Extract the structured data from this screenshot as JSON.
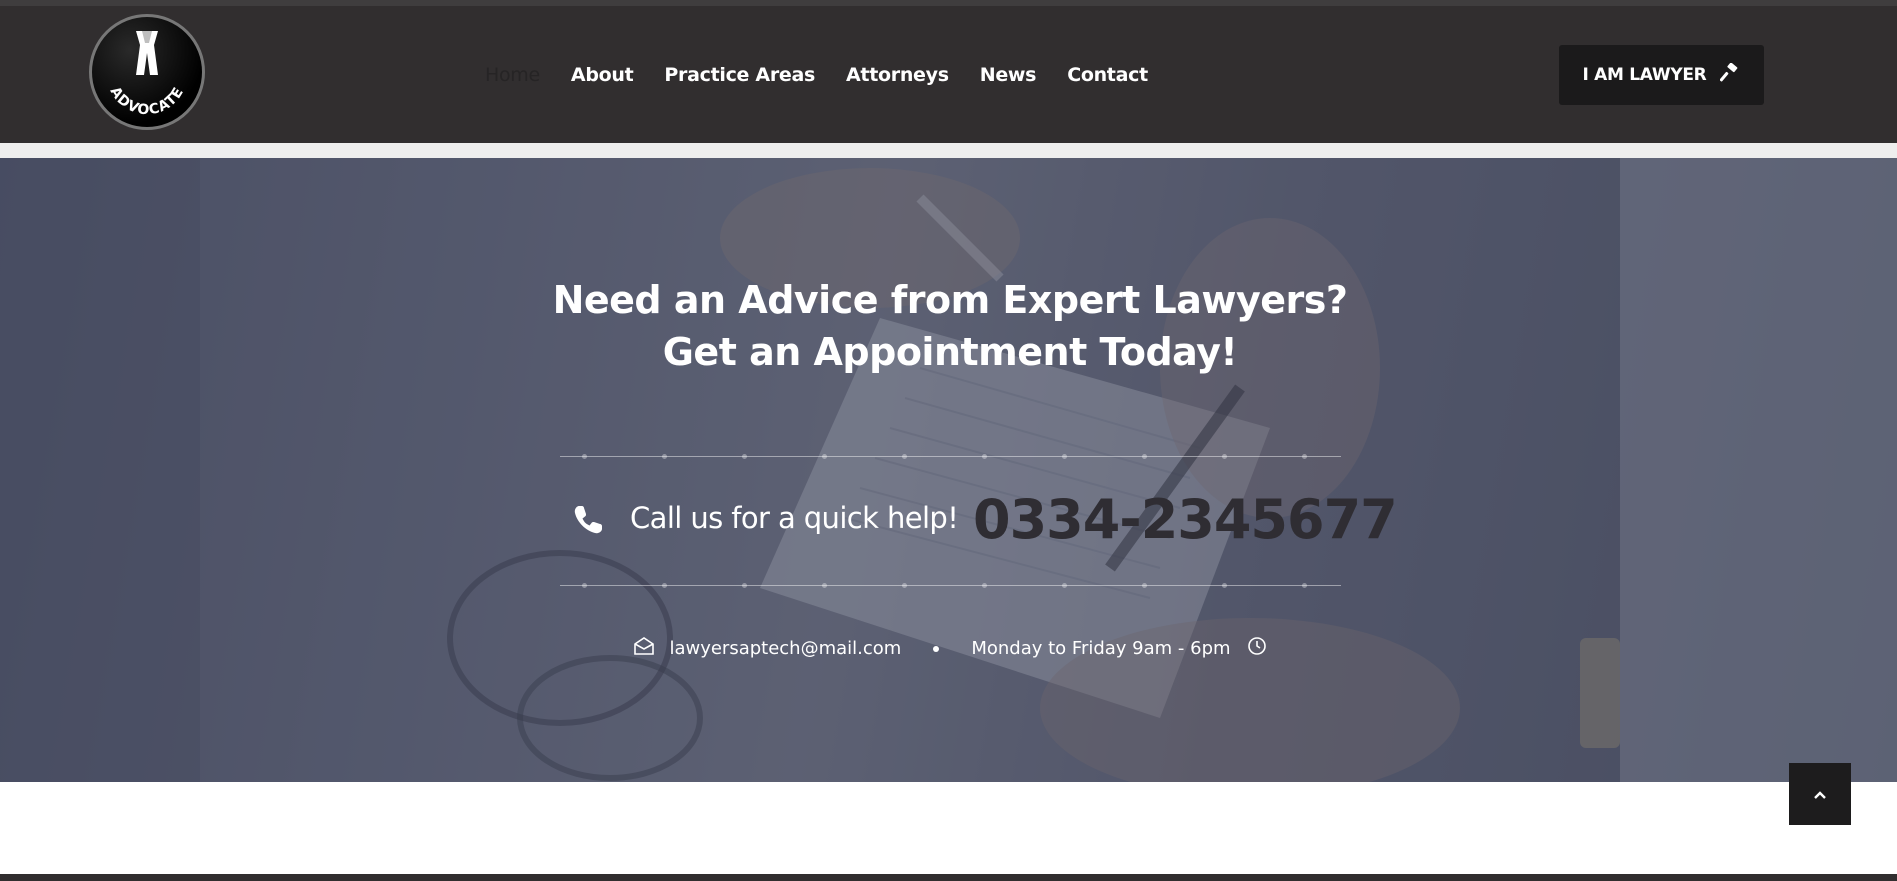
{
  "logo": {
    "text": "ADVOCATE",
    "icon": "advocate-bands-logo"
  },
  "nav": {
    "items": [
      {
        "label": "Home",
        "active": true
      },
      {
        "label": "About"
      },
      {
        "label": "Practice Areas"
      },
      {
        "label": "Attorneys"
      },
      {
        "label": "News"
      },
      {
        "label": "Contact"
      }
    ]
  },
  "header_button": {
    "label": "I AM LAWYER",
    "icon": "gavel-icon"
  },
  "hero": {
    "headline_line1": "Need an Advice from Expert Lawyers?",
    "headline_line2": "Get an Appointment Today!",
    "call_text": "Call us for a quick help!",
    "phone_number": "0334-2345677",
    "email": "lawyersaptech@mail.com",
    "hours": "Monday to Friday 9am - 6pm"
  },
  "icons": {
    "phone": "phone-icon",
    "mail": "envelope-icon",
    "clock": "clock-icon",
    "back_to_top": "chevron-up-icon"
  },
  "colors": {
    "header_bg": "#312e2f",
    "button_bg": "#1b1a1b",
    "phone_number": "#2f2d33",
    "hero_overlay": "#373c52"
  }
}
